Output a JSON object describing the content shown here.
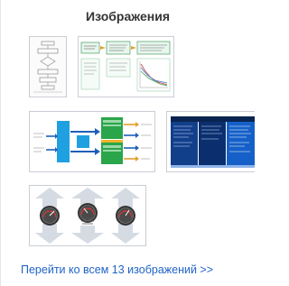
{
  "panel": {
    "title": "Изображения"
  },
  "thumbnails": [
    {
      "id": "flowchart-doc",
      "icon": "flowchart-document-thumbnail"
    },
    {
      "id": "process-diagram",
      "icon": "process-diagram-thumbnail"
    },
    {
      "id": "block-diagram",
      "icon": "block-diagram-thumbnail"
    },
    {
      "id": "table-slide",
      "icon": "blue-table-slide-thumbnail"
    },
    {
      "id": "gauges-diagram",
      "icon": "speedometer-gauges-thumbnail"
    }
  ],
  "footer": {
    "more_link": "Перейти ко всем 13 изображений >>"
  },
  "colors": {
    "link": "#1f63c6",
    "title": "#333333",
    "thumb_border": "#c9ced4"
  }
}
